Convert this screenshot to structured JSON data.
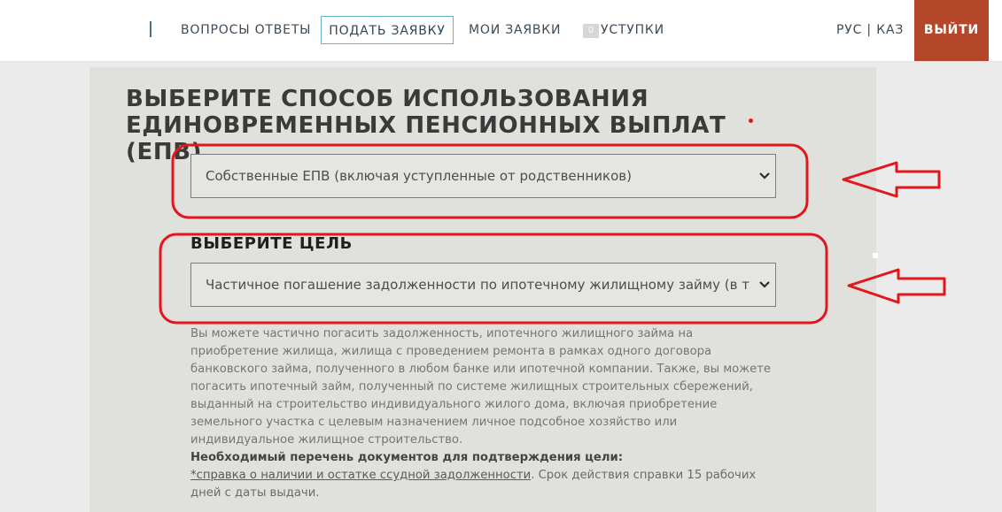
{
  "nav": {
    "faq": "ВОПРОСЫ ОТВЕТЫ",
    "apply": "ПОДАТЬ ЗАЯВКУ",
    "my_applications": "МОИ ЗАЯВКИ",
    "ceded_count": "0",
    "ceded": "УСТУПКИ",
    "lang_ru": "РУС",
    "lang_sep": "|",
    "lang_kz": "КАЗ",
    "logout": "ВЫЙТИ"
  },
  "form": {
    "title": "ВЫБЕРИТЕ СПОСОБ ИСПОЛЬЗОВАНИЯ ЕДИНОВРЕМЕННЫХ ПЕНСИОННЫХ ВЫПЛАТ (ЕПВ)",
    "method_select_value": "Собственные ЕПВ (включая уступленные от родственников)",
    "goal_label": "ВЫБЕРИТЕ ЦЕЛЬ",
    "goal_select_value": "Частичное погашение задолженности по ипотечному жилищному займу (в т",
    "description": "Вы можете частично погасить задолженность, ипотечного жилищного займа на приобретение жилища, жилища с проведением ремонта в рамках одного договора банковского займа, полученного в любом банке или ипотечной компании. Также, вы можете погасить ипотечный займ, полученный по системе жилищных строительных сбережений, выданный на строительство индивидуального жилого дома, включая приобретение земельного участка с целевым назначением личное подсобное хозяйство или индивидуальное жилищное строительство.",
    "docs_heading": "Необходимый перечень документов для подтверждения цели:",
    "docs_link": "*справка о наличии и остатке ссудной задолженности",
    "docs_note": ". Срок действия справки 15 рабочих дней с даты выдачи."
  },
  "colors": {
    "logout_bg": "#b4472a",
    "annotation_red": "#e3161b",
    "apply_border": "#63b3c9"
  }
}
